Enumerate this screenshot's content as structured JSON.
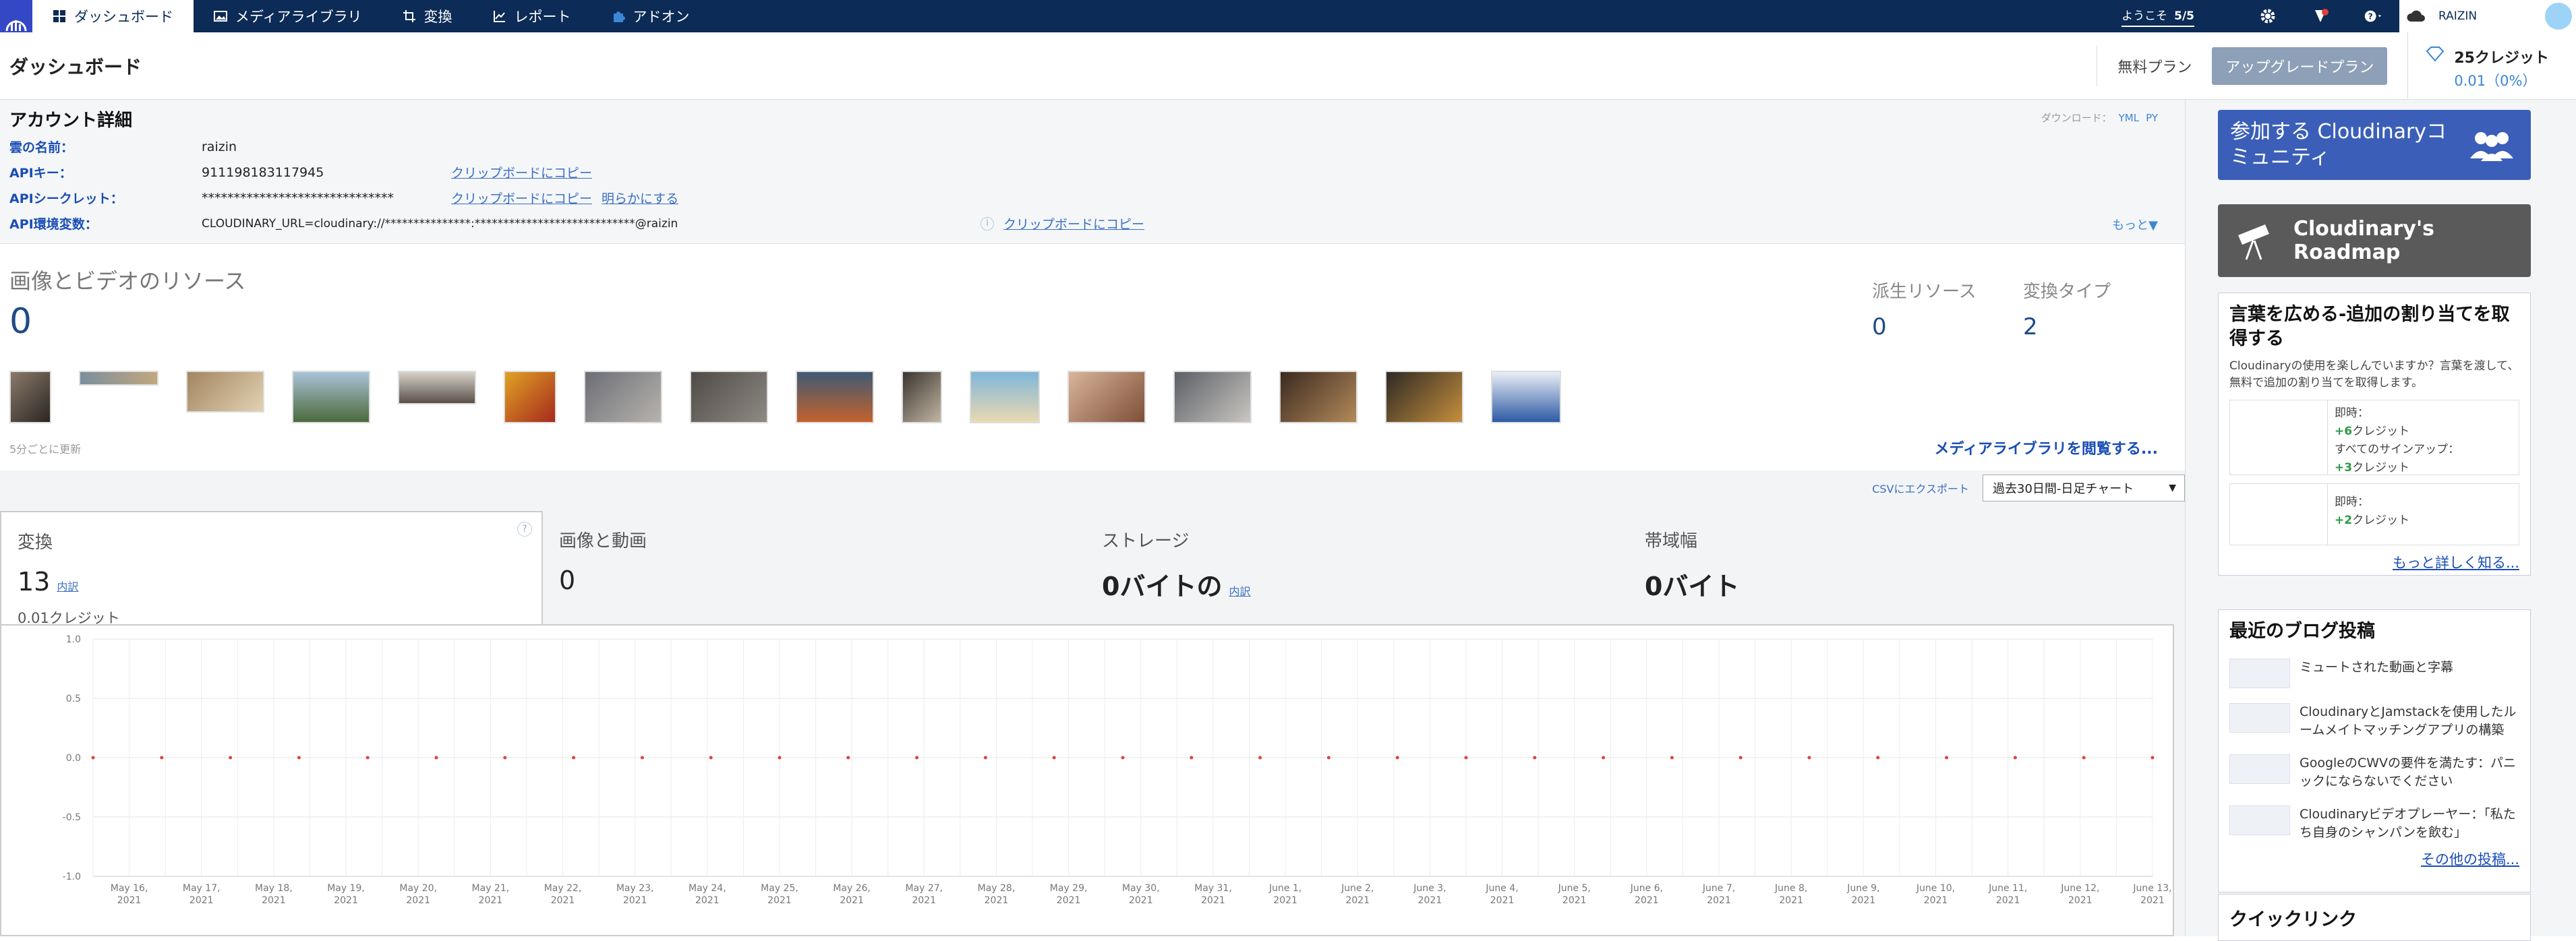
{
  "nav": {
    "items": [
      {
        "label": "ダッシュボード",
        "icon": "grid-icon"
      },
      {
        "label": "メディアライブラリ",
        "icon": "image-icon"
      },
      {
        "label": "変換",
        "icon": "crop-icon"
      },
      {
        "label": "レポート",
        "icon": "chart-icon"
      },
      {
        "label": "アドオン",
        "icon": "puzzle-icon"
      }
    ],
    "welcome": "ようこそ",
    "welcome_count": "5/5",
    "account_name": "RAIZIN"
  },
  "header": {
    "title": "ダッシュボード",
    "plan_free": "無料プラン",
    "plan_upgrade": "アップグレードプラン",
    "credits": "25クレジット",
    "credits_used": "0.01（0%）"
  },
  "account": {
    "title": "アカウント詳細",
    "download_label": "ダウンロード：",
    "download_yml": "YML",
    "download_py": "PY",
    "cloud_label": "雲の名前：",
    "cloud_value": "raizin",
    "apikey_label": "APIキー：",
    "apikey_value": "911198183117945",
    "secret_label": "APIシークレット：",
    "secret_value": "******************************",
    "env_label": "API環境変数：",
    "env_value": "CLOUDINARY_URL=cloudinary://***************:****************************@raizin",
    "copy": "クリップボードにコピー",
    "reveal": "明らかにする",
    "more": "もっと▼"
  },
  "resources": {
    "title": "画像とビデオのリソース",
    "count": "0",
    "derived_label": "派生リソース",
    "derived_value": "0",
    "transform_types_label": "変換タイプ",
    "transform_types_value": "2",
    "updated": "5分ごとに更新",
    "browse": "メディアライブラリを閲覧する..."
  },
  "usage": {
    "csv": "CSVにエクスポート",
    "range": "過去30日間-日足チャート",
    "tabs": [
      {
        "label": "変換",
        "value": "13",
        "link": "内訳",
        "credit": "0.01クレジット"
      },
      {
        "label": "画像と動画",
        "value": "0"
      },
      {
        "label": "ストレージ",
        "value": "0バイトの",
        "link": "内訳"
      },
      {
        "label": "帯域幅",
        "value": "0バイト"
      }
    ]
  },
  "chart_data": {
    "type": "line",
    "ylim": [
      -1.0,
      1.0
    ],
    "yticks": [
      "1.0",
      "0.5",
      "0.0",
      "-0.5",
      "-1.0"
    ],
    "x": [
      "May 16, 2021",
      "May 17, 2021",
      "May 18, 2021",
      "May 19, 2021",
      "May 20, 2021",
      "May 21, 2021",
      "May 22, 2021",
      "May 23, 2021",
      "May 24, 2021",
      "May 25, 2021",
      "May 26, 2021",
      "May 27, 2021",
      "May 28, 2021",
      "May 29, 2021",
      "May 30, 2021",
      "May 31, 2021",
      "June 1, 2021",
      "June 2, 2021",
      "June 3, 2021",
      "June 4, 2021",
      "June 5, 2021",
      "June 6, 2021",
      "June 7, 2021",
      "June 8, 2021",
      "June 9, 2021",
      "June 10, 2021",
      "June 11, 2021",
      "June 12, 2021",
      "June 13, 2021"
    ],
    "values": [
      0,
      0,
      0,
      0,
      0,
      0,
      0,
      0,
      0,
      0,
      0,
      0,
      0,
      0,
      0,
      0,
      0,
      0,
      0,
      0,
      0,
      0,
      0,
      0,
      0,
      0,
      0,
      0,
      0,
      0,
      0
    ],
    "grid": true,
    "series_color": "#e0413c"
  },
  "sidebar": {
    "community": "参加する Cloudinaryコミュニティ",
    "roadmap": "Cloudinary's Roadmap",
    "spread_title": "言葉を広める-追加の割り当てを取得する",
    "spread_text": "Cloudinaryの使用を楽しんでいますか？言葉を渡して、無料で追加の割り当てを取得します。",
    "q1_now": "即時：",
    "q1_a": "+6",
    "q1_credit": "クレジット",
    "q1_signup": "すべてのサインアップ：",
    "q1_b": "+3",
    "q2_now": "即時：",
    "q2_a": "+2",
    "learn_more": "もっと詳しく知る...",
    "blog_title": "最近のブログ投稿",
    "blog": [
      "ミュートされた動画と字幕",
      "CloudinaryとJamstackを使用したルームメイトマッチングアプリの構築",
      "GoogleのCWVの要件を満たす：パニックにならないでください",
      "Cloudinaryビデオプレーヤー：「私たち自身のシャンパンを飲む」"
    ],
    "other_posts": "その他の投稿...",
    "quick_links": "クイックリンク"
  },
  "colors": {
    "topbar": "#0c2b56",
    "accent": "#3448c5",
    "link": "#1a4db5"
  }
}
